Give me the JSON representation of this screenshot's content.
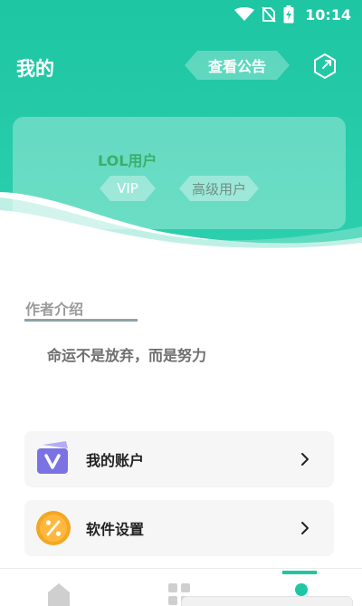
{
  "status_bar": {
    "time": "10:14",
    "icons": [
      "wifi-icon",
      "no-sim-icon",
      "battery-charging-icon"
    ]
  },
  "header": {
    "title": "我的",
    "notice_button": "查看公告",
    "exit_icon": "exit-icon"
  },
  "profile": {
    "username": "LOL用户",
    "badges": [
      "VIP",
      "高级用户"
    ]
  },
  "author": {
    "section_title": "作者介绍",
    "intro": "命运不是放弃，而是努力"
  },
  "menu": [
    {
      "label": "我的账户",
      "icon": "account-v-icon"
    },
    {
      "label": "软件设置",
      "icon": "settings-percent-icon"
    }
  ],
  "tab_bar": {
    "tabs": [
      "home-icon",
      "apps-icon",
      "profile-icon"
    ],
    "selected": 2
  },
  "colors": {
    "primary": "#1ec6a4",
    "accent_green": "#3dae6c",
    "account_icon": "#7b73e3",
    "settings_icon": "#f5a623"
  }
}
